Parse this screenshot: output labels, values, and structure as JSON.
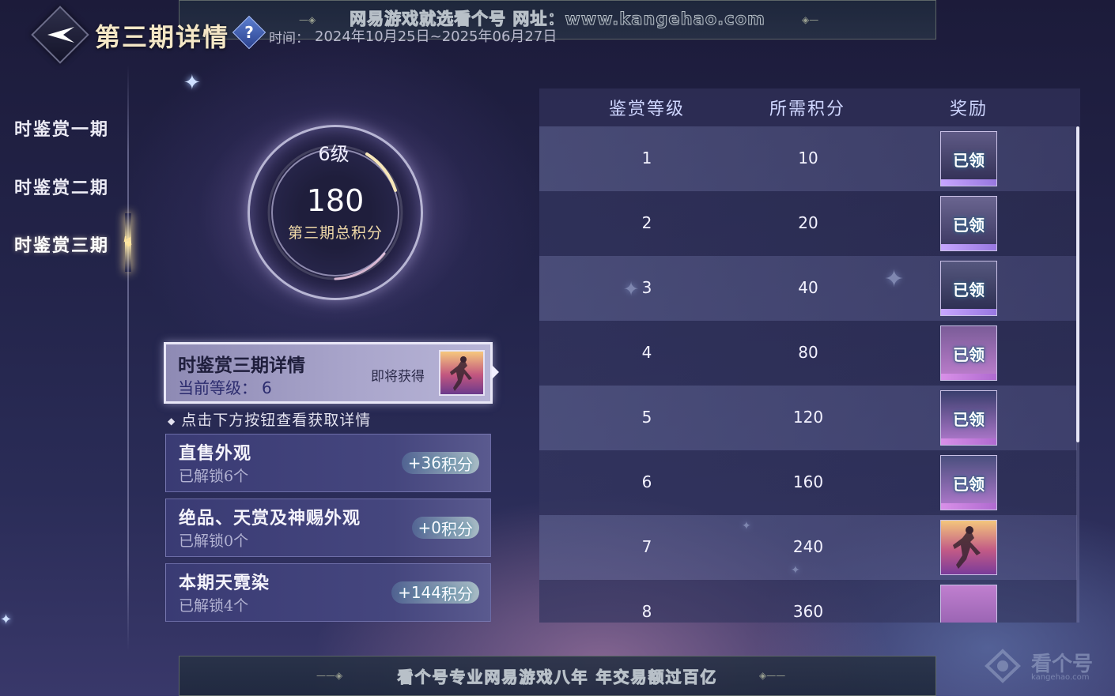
{
  "watermark_top": "网易游戏就选看个号  网址：www.kangehao.com",
  "watermark_bottom": "看个号专业网易游戏八年  年交易额过百亿",
  "watermark_logo": {
    "name": "看个号",
    "url": "kangehao.com"
  },
  "header": {
    "title": "第三期详情",
    "help_icon": "question-icon",
    "time_label": "时间：",
    "time_value": "2024年10月25日~2025年06月27日"
  },
  "sidebar": {
    "items": [
      {
        "label": "时鉴赏一期",
        "active": false
      },
      {
        "label": "时鉴赏二期",
        "active": false
      },
      {
        "label": "时鉴赏三期",
        "active": true
      }
    ]
  },
  "dial": {
    "level": "6级",
    "score": "180",
    "label": "第三期总积分"
  },
  "detail_card": {
    "title": "时鉴赏三期详情",
    "level_label": "当前等级：",
    "level_value": "6",
    "soon_label": "即将获得"
  },
  "hint": "点击下方按钮查看获取详情",
  "categories": [
    {
      "name": "直售外观",
      "sub": "已解锁6个",
      "points": "+36",
      "unit": "积分"
    },
    {
      "name": "绝品、天赏及神赐外观",
      "sub": "已解锁0个",
      "points": "+0",
      "unit": "积分"
    },
    {
      "name": "本期天霓染",
      "sub": "已解锁4个",
      "points": "+144",
      "unit": "积分"
    }
  ],
  "table": {
    "headers": [
      "鉴赏等级",
      "所需积分",
      "奖励"
    ],
    "rows": [
      {
        "level": "1",
        "points": "10",
        "reward": "已领",
        "claimed": true
      },
      {
        "level": "2",
        "points": "20",
        "reward": "已领",
        "claimed": true
      },
      {
        "level": "3",
        "points": "40",
        "reward": "已领",
        "claimed": true
      },
      {
        "level": "4",
        "points": "80",
        "reward": "已领",
        "claimed": true
      },
      {
        "level": "5",
        "points": "120",
        "reward": "已领",
        "claimed": true
      },
      {
        "level": "6",
        "points": "160",
        "reward": "已领",
        "claimed": true
      },
      {
        "level": "7",
        "points": "240",
        "reward": "",
        "claimed": false
      },
      {
        "level": "8",
        "points": "360",
        "reward": "",
        "claimed": false
      }
    ]
  },
  "colors": {
    "accent_gold": "#f4e7c6",
    "points_pill": "#9fe0e0",
    "table_header": "#cfd6ff"
  }
}
